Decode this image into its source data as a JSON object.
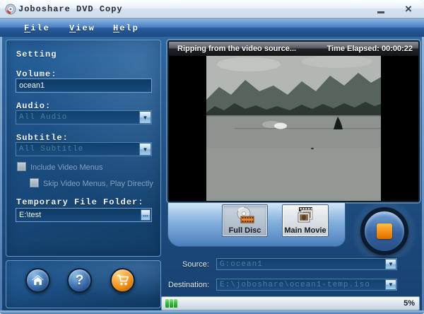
{
  "window": {
    "title": "Joboshare DVD Copy",
    "close_glyph": "×"
  },
  "menu": {
    "items": [
      {
        "label": "File",
        "u": "F",
        "rest": "ile"
      },
      {
        "label": "View",
        "u": "V",
        "rest": "iew"
      },
      {
        "label": "Help",
        "u": "H",
        "rest": "elp"
      }
    ]
  },
  "settings": {
    "heading": "Setting",
    "volume_label": "Volume:",
    "volume_value": "ocean1",
    "audio_label": "Audio:",
    "audio_value": "All Audio",
    "subtitle_label": "Subtitle:",
    "subtitle_value": "All Subtitle",
    "include_menus_label": "Include Video Menus",
    "skip_menus_label": "Skip Video Menus, Play Directly",
    "temp_folder_label": "Temporary File Folder:",
    "temp_folder_value": "E:\\test",
    "browse_glyph": "..."
  },
  "nav": {
    "help_glyph": "?"
  },
  "preview": {
    "status_text": "Ripping from the video source...",
    "time_elapsed_label": "Time Elapsed:",
    "time_elapsed_value": "00:00:22"
  },
  "modes": {
    "full_disc_label": "Full Disc",
    "main_movie_label": "Main Movie"
  },
  "output": {
    "source_label": "Source:",
    "source_value": "G:ocean1",
    "destination_label": "Destination:",
    "destination_value": "E:\\joboshare\\ocean1-temp.iso"
  },
  "statusbar": {
    "progress_percent": "5%"
  },
  "colors": {
    "accent_orange": "#f28a10",
    "panel_blue": "#1b4d80",
    "progress_green": "#3cbc3c",
    "band_blue": "#8ab4e0"
  }
}
